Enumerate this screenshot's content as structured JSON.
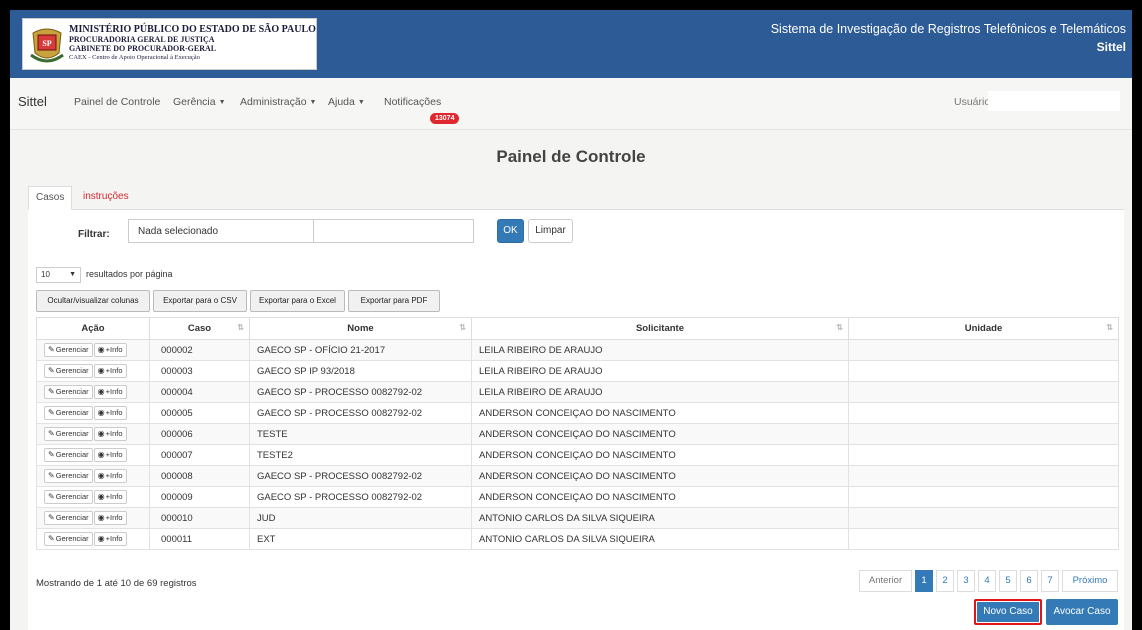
{
  "header": {
    "org_line1": "MINISTÉRIO PÚBLICO DO ESTADO DE SÃO PAULO",
    "org_line2": "PROCURADORIA GERAL DE JUSTIÇA",
    "org_line3": "GABINETE DO PROCURADOR-GERAL",
    "org_line4": "CAEX - Centro de Apoio Operacional à Execução",
    "system_title": "Sistema de Investigação de Registros Telefônicos e Telemáticos",
    "system_short": "Sittel"
  },
  "nav": {
    "brand": "Sittel",
    "items": [
      "Painel de Controle",
      "Gerência",
      "Administração",
      "Ajuda",
      "Notificações"
    ],
    "notification_count": "13074",
    "user_label": "Usuário:"
  },
  "page_title": "Painel de Controle",
  "tabs": [
    "Casos",
    "instruções"
  ],
  "filter": {
    "label": "Filtrar:",
    "selected": "Nada selecionado",
    "ok_label": "OK",
    "clear_label": "Limpar"
  },
  "length": {
    "value": "10",
    "suffix": "resultados por página"
  },
  "export_buttons": [
    "Ocultar/visualizar colunas",
    "Exportar para o CSV",
    "Exportar para o Excel",
    "Exportar para PDF"
  ],
  "table": {
    "columns": [
      "Ação",
      "Caso",
      "Nome",
      "Solicitante",
      "Unidade"
    ],
    "action_manage": "Gerenciar",
    "action_info": "+Info",
    "rows": [
      {
        "caso": "000002",
        "nome": "GAECO SP - OFÍCIO 21-2017",
        "solicitante": "LEILA RIBEIRO DE ARAUJO",
        "unidade": ""
      },
      {
        "caso": "000003",
        "nome": "GAECO SP IP 93/2018",
        "solicitante": "LEILA RIBEIRO DE ARAUJO",
        "unidade": ""
      },
      {
        "caso": "000004",
        "nome": "GAECO SP - PROCESSO 0082792-02",
        "solicitante": "LEILA RIBEIRO DE ARAUJO",
        "unidade": ""
      },
      {
        "caso": "000005",
        "nome": "GAECO SP - PROCESSO 0082792-02",
        "solicitante": "ANDERSON CONCEIÇAO DO NASCIMENTO",
        "unidade": ""
      },
      {
        "caso": "000006",
        "nome": "TESTE",
        "solicitante": "ANDERSON CONCEIÇAO DO NASCIMENTO",
        "unidade": ""
      },
      {
        "caso": "000007",
        "nome": "TESTE2",
        "solicitante": "ANDERSON CONCEIÇAO DO NASCIMENTO",
        "unidade": ""
      },
      {
        "caso": "000008",
        "nome": "GAECO SP - PROCESSO 0082792-02",
        "solicitante": "ANDERSON CONCEIÇAO DO NASCIMENTO",
        "unidade": ""
      },
      {
        "caso": "000009",
        "nome": "GAECO SP - PROCESSO 0082792-02",
        "solicitante": "ANDERSON CONCEIÇAO DO NASCIMENTO",
        "unidade": ""
      },
      {
        "caso": "000010",
        "nome": "JUD",
        "solicitante": "ANTONIO CARLOS DA SILVA SIQUEIRA",
        "unidade": ""
      },
      {
        "caso": "000011",
        "nome": "EXT",
        "solicitante": "ANTONIO CARLOS DA SILVA SIQUEIRA",
        "unidade": ""
      }
    ]
  },
  "footer": {
    "info": "Mostrando de 1 até 10 de 69 registros",
    "pagination": [
      "Anterior",
      "1",
      "2",
      "3",
      "4",
      "5",
      "6",
      "7",
      "Próximo"
    ],
    "active_page": "1",
    "new_case_label": "Novo Caso",
    "avocar_label": "Avocar Caso"
  },
  "colors": {
    "header_blue": "#2d5b96",
    "primary": "#337ab7",
    "badge_red": "#e0262e",
    "highlight_red": "#e0141a"
  },
  "icons": {
    "manage": "pencil-icon",
    "info": "eye-icon",
    "sort": "sort-arrows-icon"
  }
}
